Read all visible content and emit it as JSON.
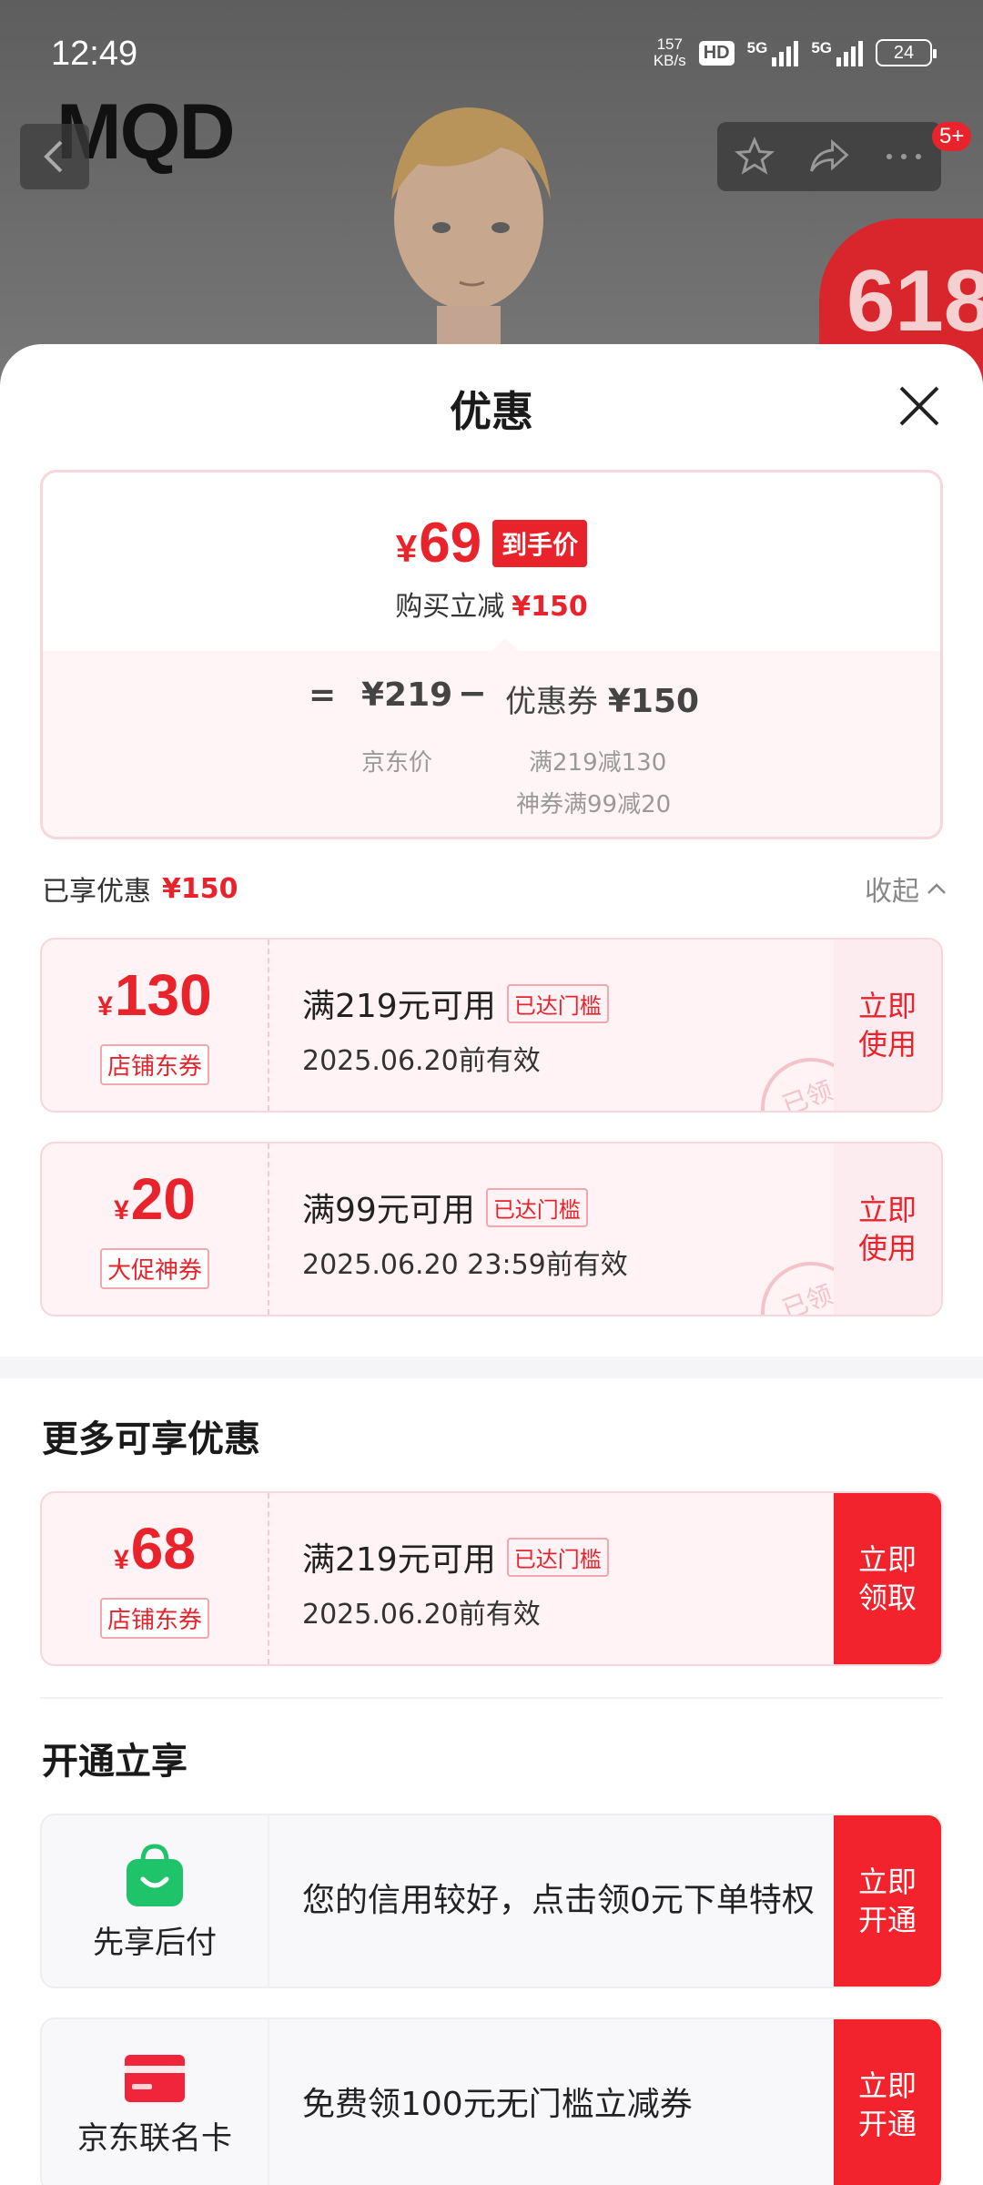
{
  "status_bar": {
    "time": "12:49",
    "net_speed_value": "157",
    "net_speed_unit": "KB/s",
    "hd_label": "HD",
    "sim1_label": "5G",
    "sim2_label": "5G",
    "battery": "24"
  },
  "header": {
    "brand": "MQD",
    "notification_count": "5+",
    "promo_text": "618"
  },
  "sheet": {
    "title": "优惠"
  },
  "summary": {
    "currency": "¥",
    "final_price": "69",
    "final_price_tag": "到手价",
    "reduce_label": "购买立减",
    "reduce_amount": "¥150",
    "eq_sign": "=",
    "jd_price": "¥219",
    "minus_sign": "−",
    "coupon_label": "优惠券",
    "coupon_amount": "¥150",
    "jd_price_label": "京东价",
    "coupon_detail_1": "满219减130",
    "coupon_detail_2": "神券满99减20"
  },
  "enjoyed": {
    "label": "已享优惠",
    "amount": "¥150",
    "collapse_label": "收起"
  },
  "enjoyed_coupons": [
    {
      "amount": "130",
      "type": "店铺东券",
      "condition": "满219元可用",
      "status": "已达门槛",
      "validity": "2025.06.20前有效",
      "action": "立即使用",
      "stamp": "已领"
    },
    {
      "amount": "20",
      "type": "大促神券",
      "condition": "满99元可用",
      "status": "已达门槛",
      "validity": "2025.06.20 23:59前有效",
      "action": "立即使用",
      "stamp": "已领"
    }
  ],
  "more": {
    "title": "更多可享优惠",
    "coupon": {
      "amount": "68",
      "type": "店铺东券",
      "condition": "满219元可用",
      "status": "已达门槛",
      "validity": "2025.06.20前有效",
      "action": "立即领取"
    }
  },
  "open": {
    "title": "开通立享",
    "services": [
      {
        "name": "先享后付",
        "icon": "shopping-bag-icon",
        "description": "您的信用较好，点击领0元下单特权",
        "action": "立即开通"
      },
      {
        "name": "京东联名卡",
        "icon": "credit-card-icon",
        "description": "免费领100元无门槛立减券",
        "action": "立即开通"
      }
    ]
  },
  "colors": {
    "accent_red": "#e8232b",
    "action_red": "#f2232c",
    "coupon_bg": "#fff3f5",
    "pay_later_green": "#1ec36a"
  }
}
